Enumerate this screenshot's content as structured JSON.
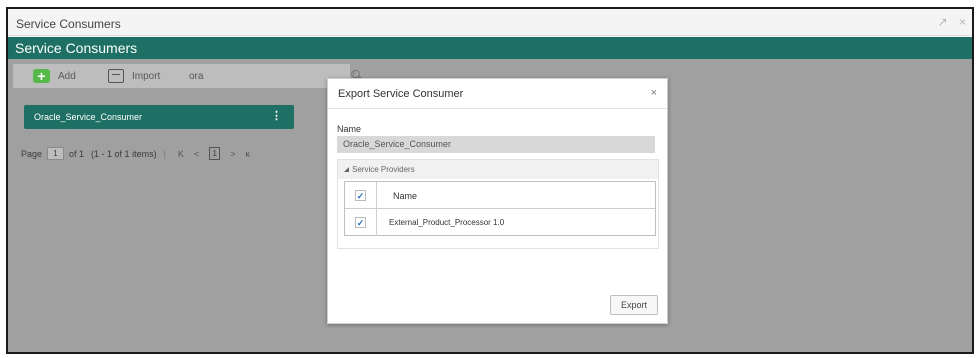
{
  "window": {
    "title": "Service Consumers",
    "controls": [
      "↗",
      "×"
    ]
  },
  "header": {
    "title": "Service Consumers"
  },
  "toolbar": {
    "add_label": "Add",
    "import_label": "Import",
    "search_value": "ora"
  },
  "consumers": [
    {
      "name": "Oracle_Service_Consumer",
      "menu": "⋮"
    }
  ],
  "pagination": {
    "page_label": "Page",
    "page_value": "1",
    "of_label": "of 1",
    "items_label": "(1 - 1 of 1 items)",
    "first": "K",
    "prev": "<",
    "current": "1",
    "next": ">",
    "last": "κ"
  },
  "modal": {
    "title": "Export Service Consumer",
    "close": "×",
    "name_label": "Name",
    "name_value": "Oracle_Service_Consumer",
    "providers_title": "Service Providers",
    "table": {
      "column": "Name",
      "rows": [
        "External_Product_Processor 1.0"
      ]
    },
    "export_label": "Export"
  },
  "colors": {
    "brand_green": "#1e7064",
    "add_green": "#55b94a",
    "overlay_gray": "#a0a0a0"
  }
}
